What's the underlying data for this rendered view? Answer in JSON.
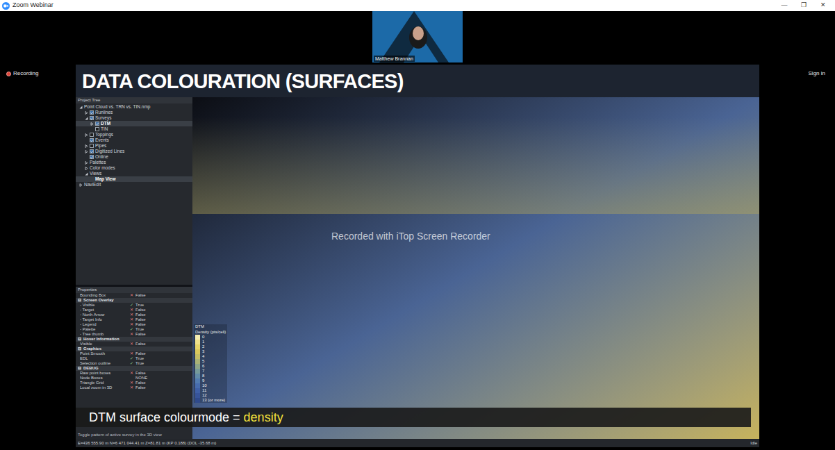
{
  "window": {
    "title": "Zoom Webinar",
    "controls": [
      "—",
      "❐",
      "✕"
    ]
  },
  "recording": {
    "label": "Recording"
  },
  "sign_in": "Sign in",
  "presenter": {
    "name": "Matthew Brannan"
  },
  "slide": {
    "title": "DATA COLOURATION (SURFACES)",
    "caption_prefix": "DTM surface colourmode = ",
    "caption_highlight": "density",
    "watermark": "Recorded with iTop Screen Recorder"
  },
  "project_tree": {
    "title": "Project Tree",
    "items": [
      {
        "label": "Point Cloud vs. TRN vs. TIN.nmp",
        "expandable": true,
        "expanded": true,
        "selected": false,
        "children": [
          {
            "label": "Runlines",
            "expandable": true,
            "expanded": false,
            "checked": true,
            "selected": false,
            "children": []
          },
          {
            "label": "Surveys",
            "expandable": true,
            "expanded": true,
            "checked": true,
            "selected": false,
            "children": [
              {
                "label": "DTM",
                "expandable": true,
                "expanded": false,
                "checked": true,
                "selected": true,
                "children": []
              },
              {
                "label": "TIN",
                "expandable": false,
                "expanded": false,
                "checked": false,
                "selected": false,
                "children": []
              }
            ]
          },
          {
            "label": "Toppings",
            "expandable": true,
            "expanded": false,
            "checked": false,
            "selected": false,
            "children": []
          },
          {
            "label": "Events",
            "expandable": false,
            "expanded": false,
            "checked": true,
            "selected": false,
            "children": []
          },
          {
            "label": "Pipes",
            "expandable": true,
            "expanded": false,
            "checked": false,
            "selected": false,
            "children": []
          },
          {
            "label": "Digitized Lines",
            "expandable": true,
            "expanded": false,
            "checked": true,
            "selected": false,
            "children": []
          },
          {
            "label": "Online",
            "expandable": false,
            "expanded": false,
            "checked": true,
            "selected": false,
            "children": []
          },
          {
            "label": "Palettes",
            "expandable": true,
            "expanded": false,
            "selected": false,
            "children": []
          },
          {
            "label": "Color modes",
            "expandable": true,
            "expanded": false,
            "selected": false,
            "children": []
          },
          {
            "label": "Views",
            "expandable": true,
            "expanded": true,
            "selected": false,
            "children": [
              {
                "label": "Map View",
                "expandable": false,
                "expanded": false,
                "selected": true,
                "children": []
              }
            ]
          }
        ]
      },
      {
        "label": "NaviEdit",
        "expandable": true,
        "expanded": false,
        "selected": false,
        "children": []
      }
    ]
  },
  "properties": {
    "title": "Properties",
    "rows": [
      {
        "kind": "prop",
        "name": "Bounding Box",
        "mark": "✕",
        "value": "False"
      },
      {
        "kind": "section",
        "toggle": "⊟",
        "name": "Screen Overlay"
      },
      {
        "kind": "prop",
        "name": "- Visible",
        "mark": "✓",
        "value": "True"
      },
      {
        "kind": "prop",
        "name": "- Target",
        "mark": "✕",
        "value": "False"
      },
      {
        "kind": "prop",
        "name": "- North Arrow",
        "mark": "✕",
        "value": "False"
      },
      {
        "kind": "prop",
        "name": "- Target Info",
        "mark": "✕",
        "value": "False"
      },
      {
        "kind": "prop",
        "name": "- Legend",
        "mark": "✕",
        "value": "False"
      },
      {
        "kind": "prop",
        "name": "- Palette",
        "mark": "✓",
        "value": "True"
      },
      {
        "kind": "prop",
        "name": "- Tree thumb",
        "mark": "✕",
        "value": "False"
      },
      {
        "kind": "section",
        "toggle": "⊟",
        "name": "Hover Information"
      },
      {
        "kind": "prop",
        "name": "Visible",
        "mark": "✕",
        "value": "False"
      },
      {
        "kind": "section",
        "toggle": "⊟",
        "name": "Graphics"
      },
      {
        "kind": "prop",
        "name": "Point Smooth",
        "mark": "✕",
        "value": "False"
      },
      {
        "kind": "prop",
        "name": "EDL",
        "mark": "✓",
        "value": "True"
      },
      {
        "kind": "prop",
        "name": "Selection outline",
        "mark": "✓",
        "value": "True"
      },
      {
        "kind": "section",
        "toggle": "⊟",
        "name": "DEBUG"
      },
      {
        "kind": "prop",
        "name": "Raw point boxes",
        "mark": "✕",
        "value": "False"
      },
      {
        "kind": "prop",
        "name": "Node Boxes",
        "mark": "",
        "value": "NONE"
      },
      {
        "kind": "prop",
        "name": "Triangle Grid",
        "mark": "✕",
        "value": "False"
      },
      {
        "kind": "prop",
        "name": "Local zoom in 3D",
        "mark": "✕",
        "value": "False"
      }
    ],
    "description": "Toggle pattern of active survey in the 3D view"
  },
  "legend": {
    "title": "DTM",
    "subtitle": "Density (pts/cell)",
    "entries": [
      {
        "label": "0",
        "color": "#f4ecb0"
      },
      {
        "label": "1",
        "color": "#eee08a"
      },
      {
        "label": "2",
        "color": "#e6d46a"
      },
      {
        "label": "3",
        "color": "#d9c75c"
      },
      {
        "label": "4",
        "color": "#c4bd66"
      },
      {
        "label": "5",
        "color": "#a9b276"
      },
      {
        "label": "6",
        "color": "#8ea688"
      },
      {
        "label": "7",
        "color": "#769a9a"
      },
      {
        "label": "8",
        "color": "#628ba8"
      },
      {
        "label": "9",
        "color": "#527bb0"
      },
      {
        "label": "10",
        "color": "#476cae"
      },
      {
        "label": "11",
        "color": "#3e5fa6"
      },
      {
        "label": "12",
        "color": "#37549a"
      },
      {
        "label": "13 (or more)",
        "color": "#2f4a8c"
      }
    ]
  },
  "status_bar": {
    "coords": "E=436 555.90 m N=6 471 044.41 m Z=81.81 m (KP 0.188) (DOL -35.68 m)",
    "state": "Idle"
  }
}
